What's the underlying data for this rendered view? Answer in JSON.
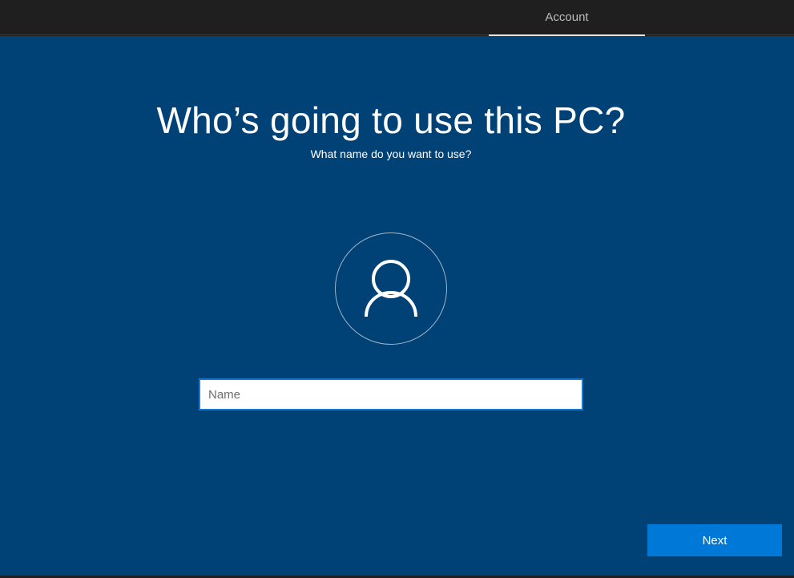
{
  "header": {
    "tabs": [
      {
        "label": "Account",
        "active": true
      }
    ]
  },
  "main": {
    "title": "Who’s going to use this PC?",
    "subtitle": "What name do you want to use?",
    "avatar_icon": "user-icon",
    "name_input": {
      "value": "",
      "placeholder": "Name"
    },
    "next_label": "Next"
  },
  "colors": {
    "background": "#004275",
    "topbar": "#1f1f1f",
    "accent": "#0078d7",
    "input_border": "#1a78d0"
  }
}
